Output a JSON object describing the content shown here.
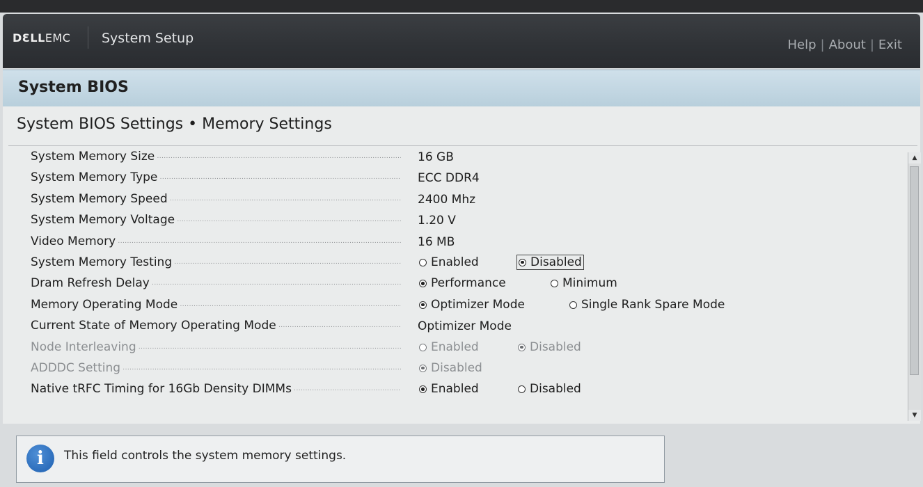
{
  "header": {
    "logo_bold": "DƐLL",
    "logo_rest": "EMC",
    "app_title": "System Setup",
    "links": {
      "help": "Help",
      "about": "About",
      "exit": "Exit",
      "separator": "|"
    }
  },
  "page": {
    "title": "System BIOS",
    "breadcrumb": "System BIOS Settings • Memory Settings"
  },
  "settings": [
    {
      "label": "System Memory Size",
      "value": "16 GB"
    },
    {
      "label": "System Memory Type",
      "value": "ECC DDR4"
    },
    {
      "label": "System Memory Speed",
      "value": "2400 Mhz"
    },
    {
      "label": "System Memory Voltage",
      "value": "1.20 V"
    },
    {
      "label": "Video Memory",
      "value": "16 MB"
    },
    {
      "label": "System Memory Testing",
      "options": [
        "Enabled",
        "Disabled"
      ],
      "selected": "Disabled"
    },
    {
      "label": "Dram Refresh Delay",
      "options": [
        "Performance",
        "Minimum"
      ],
      "selected": "Performance"
    },
    {
      "label": "Memory Operating Mode",
      "options": [
        "Optimizer Mode",
        "Single Rank Spare Mode"
      ],
      "selected": "Optimizer Mode"
    },
    {
      "label": "Current State of Memory Operating Mode",
      "value": "Optimizer Mode"
    },
    {
      "label": "Node Interleaving",
      "options": [
        "Enabled",
        "Disabled"
      ],
      "selected": "Disabled",
      "disabled": true
    },
    {
      "label": "ADDDC Setting",
      "options": [
        "Disabled"
      ],
      "selected": "Disabled",
      "disabled": true
    },
    {
      "label": "Native tRFC Timing for 16Gb Density DIMMs",
      "options": [
        "Enabled",
        "Disabled"
      ],
      "selected": "Enabled"
    }
  ],
  "help": {
    "text": "This field controls the system memory settings.",
    "icon": "info-icon"
  },
  "colors": {
    "header_bg": "#2f3236",
    "title_bar": "#c4d8e4",
    "panel_bg": "#eaecec",
    "info_icon": "#2a6fc2"
  }
}
